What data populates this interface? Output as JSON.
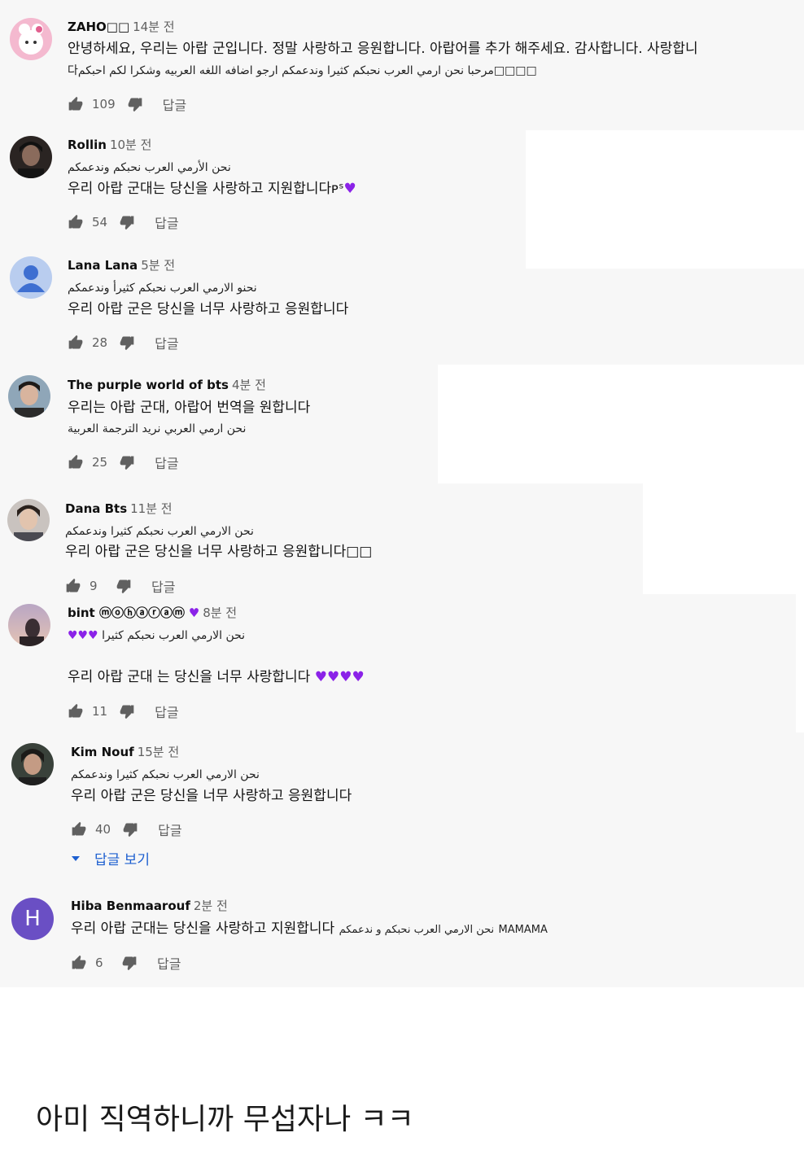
{
  "colors": {
    "background": "#f7f7f7",
    "link": "#1d5fd0",
    "heart": "#8b22e8",
    "avatar_h": "#6a4fc4"
  },
  "comments": [
    {
      "author": "ZAHO□□",
      "time": "14분 전",
      "lines": [
        "안녕하세요, 우리는 아랍 군입니다. 정말 사랑하고 응원합니다. 아랍어를 추가 해주세요. 감사합니다. 사랑합니",
        "다مرحبا نحن ارمي العرب نحبكم كثيرا وندعمكم ارجو اضافه اللغه العربيه وشكرا لكم احبكم□□□□"
      ],
      "likes": "109",
      "reply": "답글"
    },
    {
      "author": "Rollin",
      "time": "10분 전",
      "lines": [
        "نحن الأرمي العرب نحبكم وندعمكم",
        "우리 아랍 군대는 당신을 사랑하고 지원합니다ᴘˢ"
      ],
      "heart": "♥",
      "likes": "54",
      "reply": "답글"
    },
    {
      "author": "Lana Lana",
      "time": "5분 전",
      "lines": [
        "نحنو الارمي العرب نحبكم كثيرأ وندعمكم",
        "우리 아랍 군은 당신을 너무 사랑하고 응원합니다"
      ],
      "likes": "28",
      "reply": "답글"
    },
    {
      "author": "The purple world of bts",
      "time": "4분 전",
      "lines": [
        "우리는 아랍 군대, 아랍어 번역을 원합니다",
        "نحن ارمي العربي نريد الترجمة العربية"
      ],
      "likes": "25",
      "reply": "답글"
    },
    {
      "author": "Dana Bts",
      "time": "11분 전",
      "lines": [
        "نحن الارمي العرب نحبكم كثيرا وندعمكم",
        "우리 아랍 군은 당신을 너무 사랑하고 응원합니다□□"
      ],
      "likes": "9",
      "reply": "답글"
    },
    {
      "author": "bint ⓜⓞⓗⓐⓡⓐⓜ",
      "author_heart": "♥",
      "time": "8분 전",
      "lines": [
        "نحن الارمي العرب نحبكم كثيرا",
        "우리 아랍 군대 는 당신을 너무 사랑합니다"
      ],
      "hearts_line1": "♥♥♥",
      "hearts_line2": "♥♥♥♥",
      "likes": "11",
      "reply": "답글"
    },
    {
      "author": "Kim Nouf",
      "time": "15분 전",
      "lines": [
        "نحن الارمي العرب نحبكم كثيرا وندعمكم",
        "우리 아랍 군은 당신을 너무 사랑하고 응원합니다"
      ],
      "likes": "40",
      "reply": "답글",
      "view_replies": "답글 보기"
    },
    {
      "author": "Hiba Benmaarouf",
      "time": "2분 전",
      "avatar_letter": "H",
      "lines": [
        "우리 아랍 군대는 당신을 사랑하고 지원합니다",
        "نحن الارمي العرب نحبكم و ندعمكم",
        "MAMAMA"
      ],
      "likes": "6",
      "reply": "답글"
    }
  ],
  "caption": "아미 직역하니까 무섭자나 ㅋㅋ"
}
